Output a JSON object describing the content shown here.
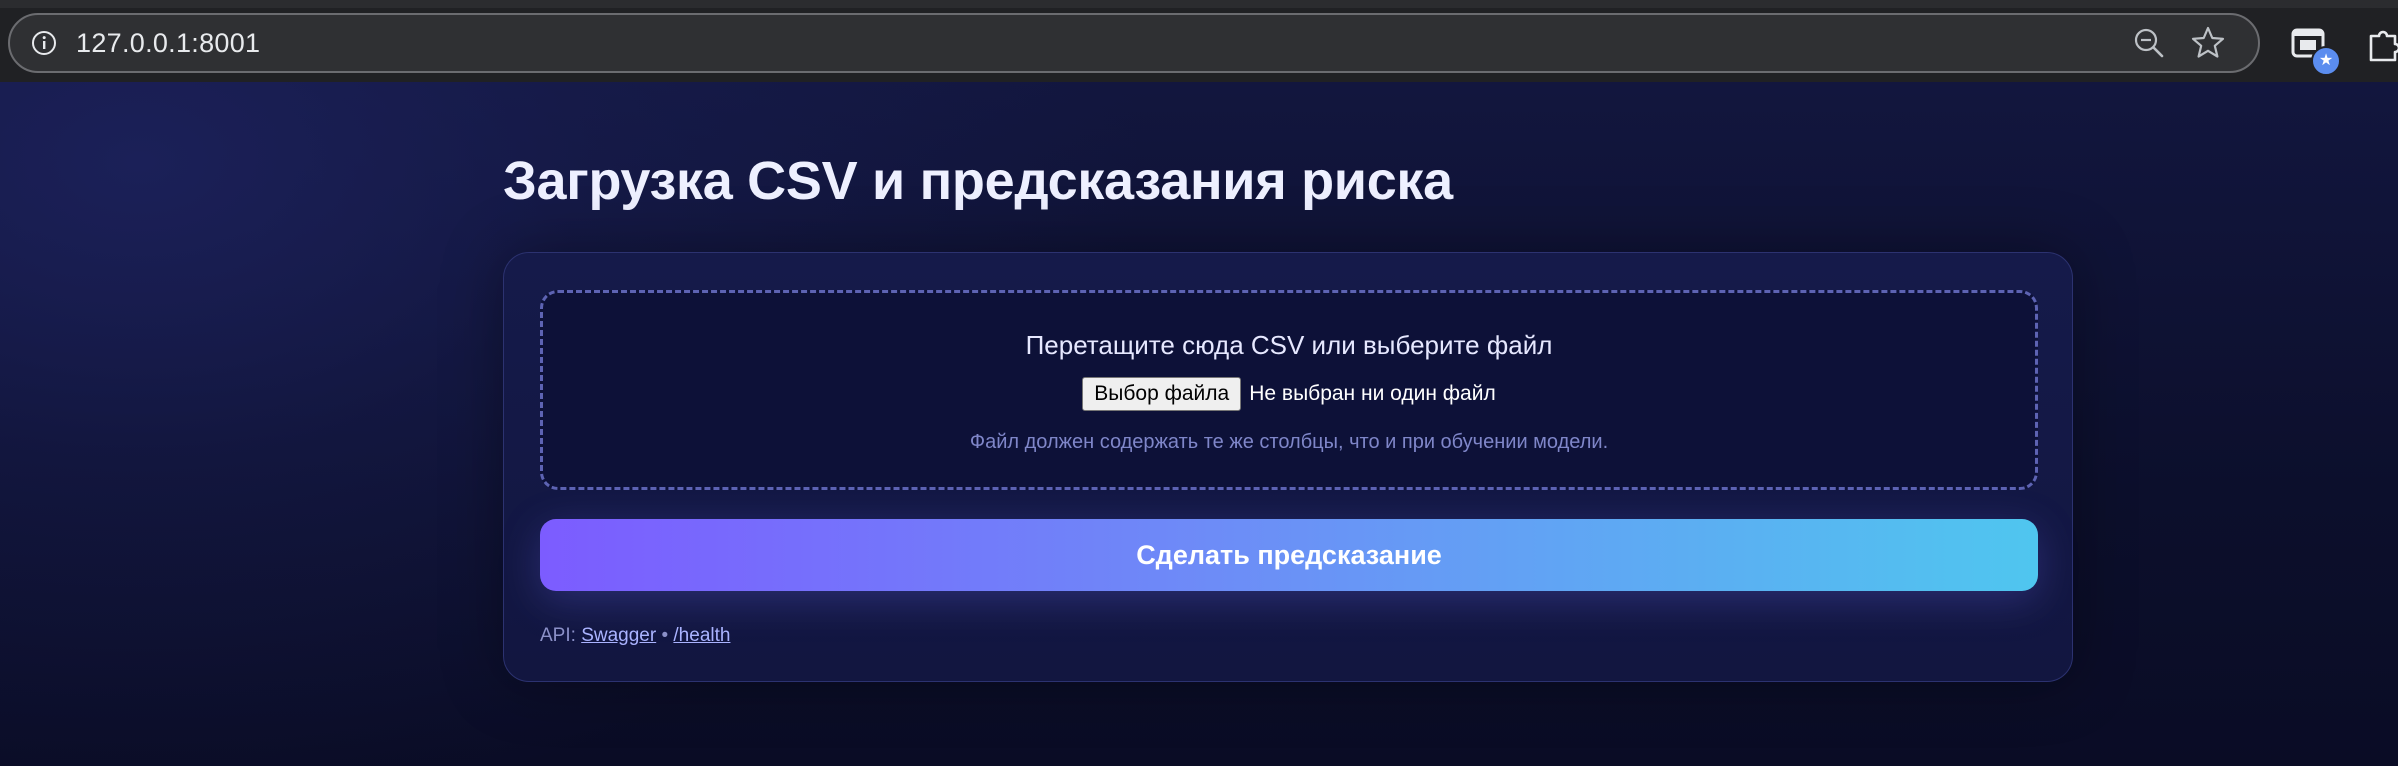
{
  "browser": {
    "url": "127.0.0.1:8001",
    "icons": {
      "site_info": "info-icon",
      "zoom": "zoom-out-icon",
      "bookmark": "star-icon",
      "extension": "extension-icon",
      "extension_badge": "★",
      "puzzle": "puzzle-icon"
    }
  },
  "page": {
    "title": "Загрузка CSV и предсказания риска",
    "dropzone": {
      "title": "Перетащите сюда CSV или выберите файл",
      "file_button_label": "Выбор файла",
      "file_status": "Не выбран ни один файл",
      "hint": "Файл должен содержать те же столбцы, что и при обучении модели."
    },
    "predict_button_label": "Сделать предсказание",
    "api": {
      "prefix": "API:",
      "swagger_label": "Swagger",
      "separator": "•",
      "health_label": "/health"
    }
  },
  "colors": {
    "background": "#0d1130",
    "card": "#151a4a",
    "button_gradient_start": "#7c5cff",
    "button_gradient_end": "#4fc6ef",
    "dashed_border": "#5d63b3"
  }
}
